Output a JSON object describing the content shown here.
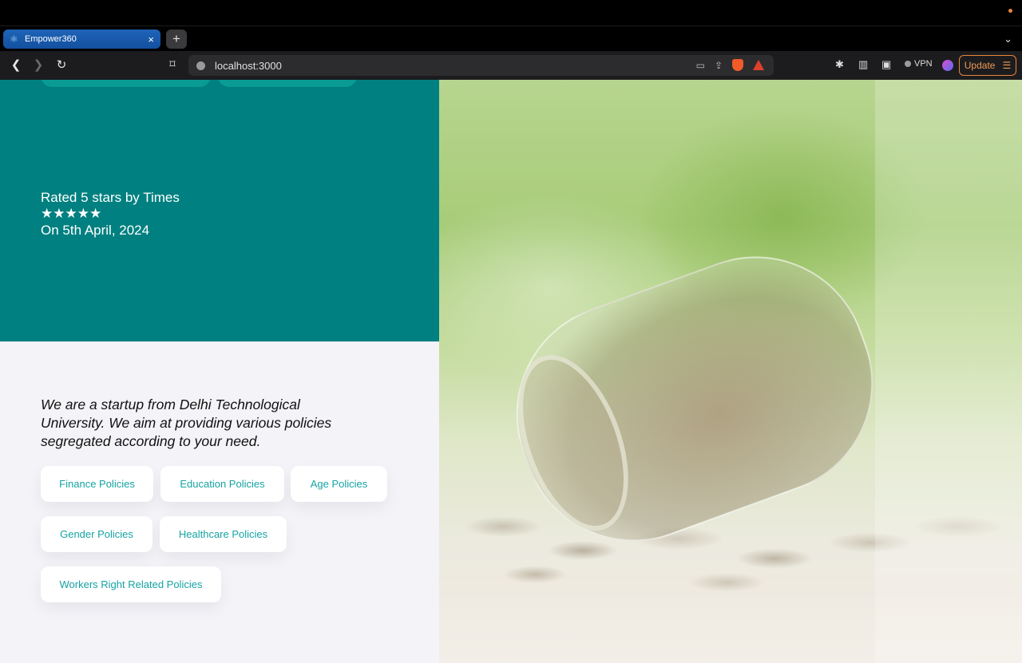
{
  "browser": {
    "tab_title": "Empower360",
    "tab_close": "×",
    "new_tab": "+",
    "tab_menu": "⌄",
    "url": "localhost:3000",
    "vpn_label": "VPN",
    "update_label": "Update",
    "accent_color": "#e8863a"
  },
  "hero": {
    "rating_text": "Rated 5 stars by Times",
    "stars": "★★★★★",
    "rating_value": 5,
    "rating_date": "On 5th April, 2024",
    "background_color": "#008080"
  },
  "about": {
    "text": "We are a startup from Delhi Technological University. We aim at providing various policies segregated according to your need."
  },
  "policies": [
    "Finance Policies",
    "Education Policies",
    "Age Policies",
    "Gender Policies",
    "Healthcare Policies",
    "Workers Right Related Policies"
  ],
  "image": {
    "subject": "coins-jar-photo"
  }
}
